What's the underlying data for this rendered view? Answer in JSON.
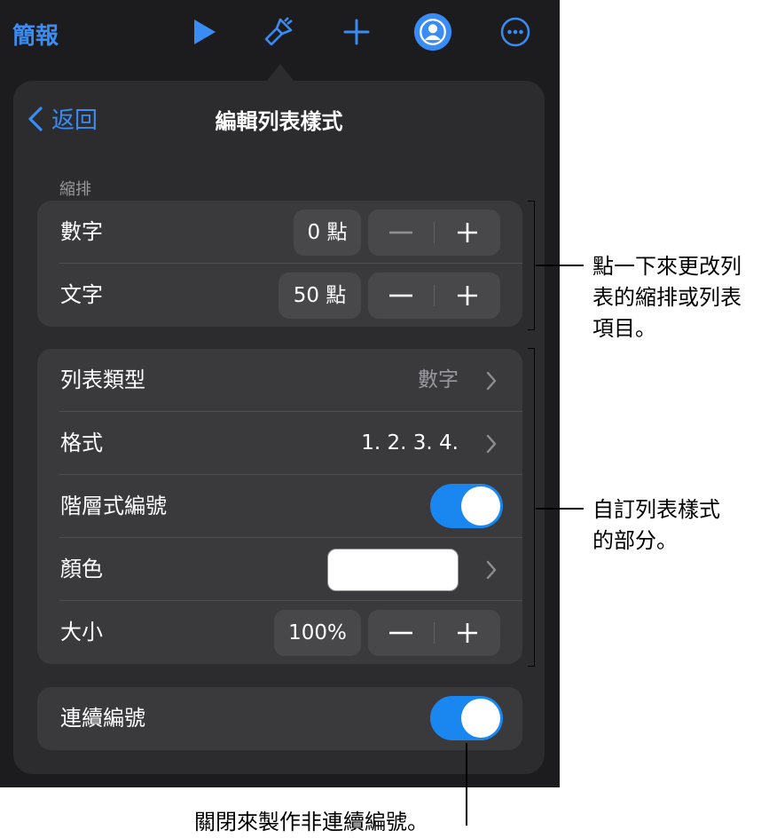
{
  "topbar": {
    "title": "簡報",
    "icons": [
      "play-icon",
      "paintbrush-icon",
      "add-icon",
      "collaborate-icon",
      "more-icon"
    ]
  },
  "popover": {
    "back_label": "返回",
    "title": "編輯列表樣式",
    "indent_section_label": "縮排",
    "indent": {
      "number_label": "數字",
      "number_value": "0 點",
      "text_label": "文字",
      "text_value": "50 點"
    },
    "list": {
      "type_label": "列表類型",
      "type_value": "數字",
      "format_label": "格式",
      "format_value": "1. 2. 3. 4.",
      "tiered_label": "階層式編號",
      "tiered_on": true,
      "color_label": "顏色",
      "color_value": "#ffffff",
      "size_label": "大小",
      "size_value": "100%"
    },
    "continue": {
      "label": "連續編號",
      "on": true
    }
  },
  "callouts": {
    "indent": "點一下來更改列\n表的縮排或列表\n項目。",
    "customize": "自訂列表樣式\n的部分。",
    "continue": "關閉來製作非連續編號。"
  },
  "colors": {
    "accent": "#3a8cf5",
    "toggle_on": "#1a86f0",
    "panel_bg": "#2c2c2e",
    "group_bg": "#3a3a3c"
  }
}
